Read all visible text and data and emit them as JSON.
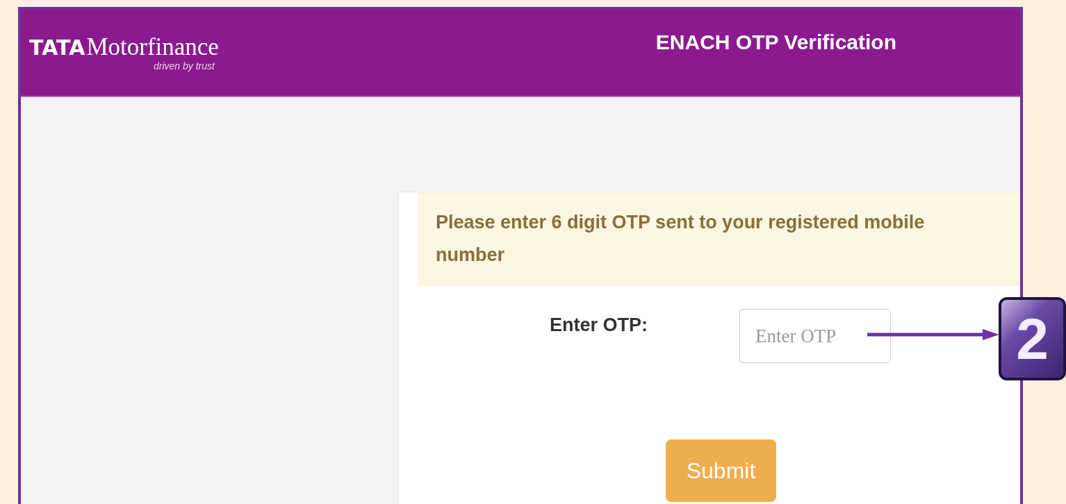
{
  "header": {
    "logo": {
      "brand": "TATA",
      "name": "Motorfinance",
      "tagline": "driven by trust"
    },
    "title": "ENACH OTP Verification"
  },
  "card": {
    "alert": "Please enter 6 digit OTP sent to your registered mobile number",
    "otp_label": "Enter OTP:",
    "otp_field": {
      "placeholder": "Enter OTP"
    },
    "submit": "Submit"
  },
  "annotation": {
    "step": "2"
  }
}
